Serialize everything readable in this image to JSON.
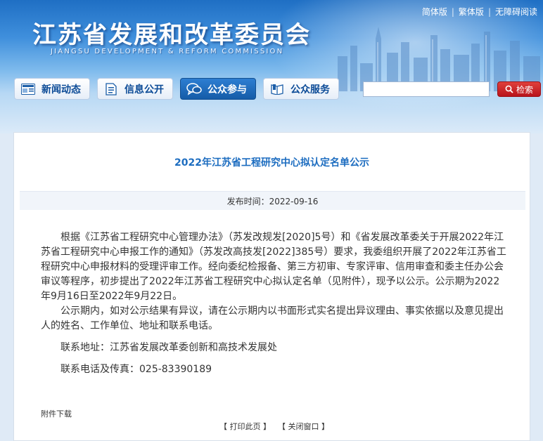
{
  "header": {
    "site_title": "江苏省发展和改革委员会",
    "site_subtitle": "JIANGSU DEVELOPMENT & REFORM COMMISSION",
    "lang_links": [
      "简体版",
      "繁体版",
      "无障碍阅读"
    ]
  },
  "nav": {
    "items": [
      {
        "label": "新闻动态",
        "icon": "newspaper-icon"
      },
      {
        "label": "信息公开",
        "icon": "document-icon"
      },
      {
        "label": "公众参与",
        "icon": "chat-icon",
        "active": true
      },
      {
        "label": "公众服务",
        "icon": "book-icon"
      }
    ]
  },
  "search": {
    "value": "",
    "button_label": "检索"
  },
  "article": {
    "title": "2022年江苏省工程研究中心拟认定名单公示",
    "publish_time": "发布时间：2022-09-16",
    "paragraphs": [
      "根据《江苏省工程研究中心管理办法》（苏发改规发[2020]5号）和《省发展改革委关于开展2022年江苏省工程研究中心申报工作的通知》（苏发改高技发[2022]385号）要求，我委组织开展了2022年江苏省工程研究中心申报材料的受理评审工作。经向委纪检报备、第三方初审、专家评审、信用审查和委主任办公会审议等程序，初步提出了2022年江苏省工程研究中心拟认定名单（见附件），现予以公示。公示期为2022年9月16日至2022年9月22日。",
      "公示期内，如对公示结果有异议，请在公示期内以书面形式实名提出异议理由、事实依据以及意见提出人的姓名、工作单位、地址和联系电话。"
    ],
    "contact_address": "联系地址：江苏省发展改革委创新和高技术发展处",
    "contact_phone": "联系电话及传真：025-83390189",
    "attachment_label": "附件下载",
    "print_link": "【 打印此页 】",
    "close_link": "【 关闭窗口 】"
  },
  "colors": {
    "accent_blue": "#1d6dc0",
    "search_red": "#c8161d",
    "nav_active": "#1f6cbf"
  }
}
